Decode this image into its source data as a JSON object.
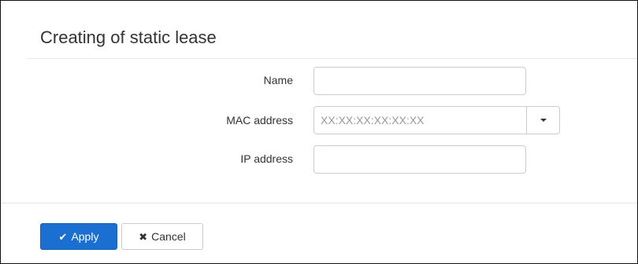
{
  "panel": {
    "title": "Creating of static lease"
  },
  "form": {
    "name": {
      "label": "Name",
      "value": "",
      "placeholder": ""
    },
    "mac": {
      "label": "MAC address",
      "value": "",
      "placeholder": "XX:XX:XX:XX:XX:XX"
    },
    "ip": {
      "label": "IP address",
      "value": "",
      "placeholder": ""
    }
  },
  "buttons": {
    "apply": {
      "label": "Apply",
      "icon": "check-icon",
      "color": "#1a6fd0"
    },
    "cancel": {
      "label": "Cancel",
      "icon": "close-icon"
    }
  },
  "icons": {
    "check": "✔",
    "close": "✖"
  }
}
